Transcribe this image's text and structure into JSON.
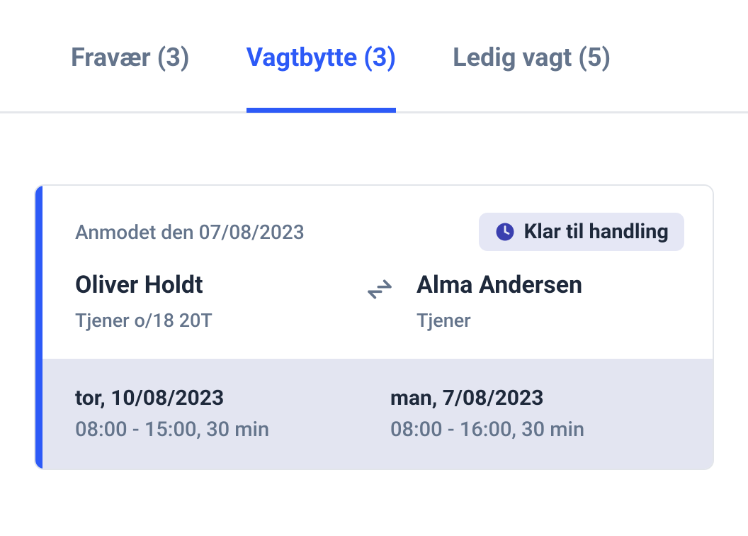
{
  "tabs": [
    {
      "label": "Fravær (3)",
      "active": false
    },
    {
      "label": "Vagtbytte (3)",
      "active": true
    },
    {
      "label": "Ledig vagt (5)",
      "active": false
    }
  ],
  "card": {
    "requested": "Anmodet den 07/08/2023",
    "status": "Klar til handling",
    "person_left": {
      "name": "Oliver Holdt",
      "role": "Tjener o/18 20T"
    },
    "person_right": {
      "name": "Alma Andersen",
      "role": "Tjener"
    },
    "shift_left": {
      "date": "tor, 10/08/2023",
      "time": "08:00 - 15:00, 30 min"
    },
    "shift_right": {
      "date": "man, 7/08/2023",
      "time": "08:00 - 16:00, 30 min"
    }
  },
  "icons": {
    "clock": "clock-icon",
    "swap": "swap-icon"
  }
}
